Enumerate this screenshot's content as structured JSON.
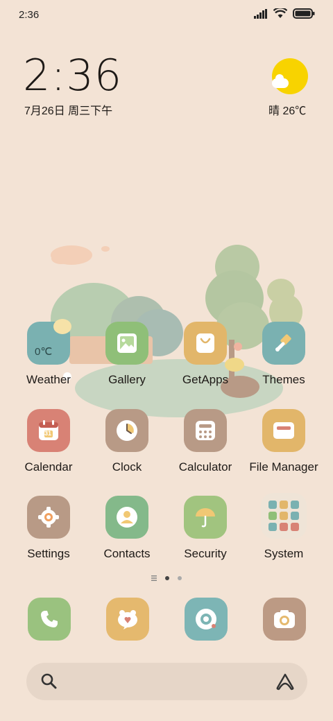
{
  "status": {
    "time": "2:36"
  },
  "clock": {
    "time": "2:36",
    "date": "7月26日 周三下午"
  },
  "weather": {
    "text": "晴 26℃",
    "widget_temp": "0℃"
  },
  "apps": [
    {
      "label": "Weather",
      "color": "#7ab1b1"
    },
    {
      "label": "Gallery",
      "color": "#8fbf78"
    },
    {
      "label": "GetApps",
      "color": "#e2b66a"
    },
    {
      "label": "Themes",
      "color": "#7ab1b1"
    },
    {
      "label": "Calendar",
      "color": "#d88275",
      "day": "31"
    },
    {
      "label": "Clock",
      "color": "#b89a86"
    },
    {
      "label": "Calculator",
      "color": "#b89a86"
    },
    {
      "label": "File Manager",
      "color": "#e2b66a"
    },
    {
      "label": "Settings",
      "color": "#b89a86"
    },
    {
      "label": "Contacts",
      "color": "#84b98a"
    },
    {
      "label": "Security",
      "color": "#a1c47f"
    },
    {
      "label": "System",
      "color": "#efe4d7"
    }
  ],
  "dock": [
    {
      "name": "phone-icon",
      "color": "#9ac27f"
    },
    {
      "name": "messages-icon",
      "color": "#e5b96e"
    },
    {
      "name": "browser-icon",
      "color": "#7db5b5"
    },
    {
      "name": "camera-icon",
      "color": "#bc9a84"
    }
  ]
}
